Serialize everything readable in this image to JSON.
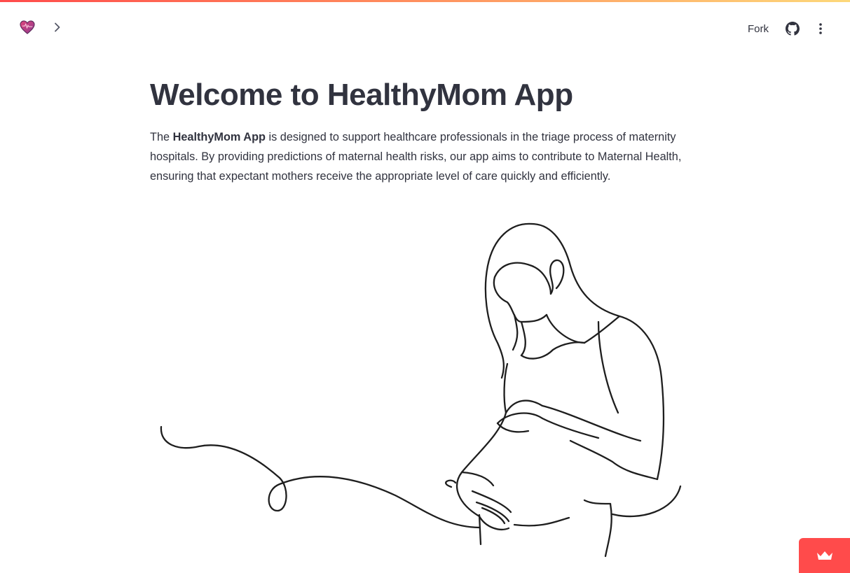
{
  "header": {
    "fork_label": "Fork",
    "icons": {
      "favicon": "heart-icon",
      "sidebar_toggle": "chevron-right-icon",
      "github": "github-icon",
      "menu": "kebab-menu-icon"
    }
  },
  "main": {
    "title": "Welcome to HealthyMom App",
    "intro": {
      "prefix": "The ",
      "bold": "HealthyMom App",
      "rest": " is designed to support healthcare professionals in the triage process of maternity hospitals. By providing predictions of maternal health risks, our app aims to contribute to Maternal Health, ensuring that expectant mothers receive the appropriate level of care quickly and efficiently."
    },
    "illustration": "pregnant-woman-line-art"
  },
  "footer": {
    "badge_icon": "crown-icon"
  },
  "colors": {
    "accent": "#ff4b4b",
    "text": "#31333f",
    "stripe_start": "#ff4b4b",
    "stripe_end": "#fdd87a"
  }
}
